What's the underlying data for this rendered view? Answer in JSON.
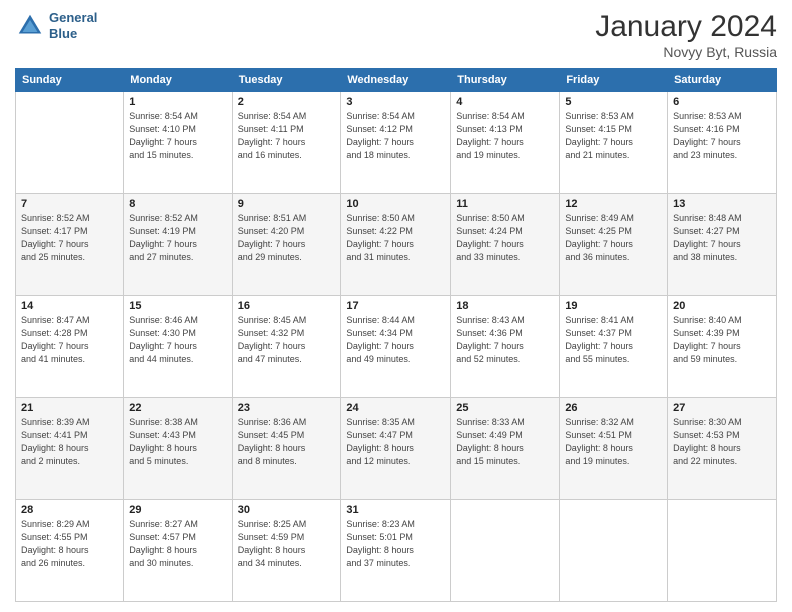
{
  "header": {
    "logo_line1": "General",
    "logo_line2": "Blue",
    "title": "January 2024",
    "subtitle": "Novyy Byt, Russia"
  },
  "weekdays": [
    "Sunday",
    "Monday",
    "Tuesday",
    "Wednesday",
    "Thursday",
    "Friday",
    "Saturday"
  ],
  "weeks": [
    [
      {
        "day": "",
        "info": ""
      },
      {
        "day": "1",
        "info": "Sunrise: 8:54 AM\nSunset: 4:10 PM\nDaylight: 7 hours\nand 15 minutes."
      },
      {
        "day": "2",
        "info": "Sunrise: 8:54 AM\nSunset: 4:11 PM\nDaylight: 7 hours\nand 16 minutes."
      },
      {
        "day": "3",
        "info": "Sunrise: 8:54 AM\nSunset: 4:12 PM\nDaylight: 7 hours\nand 18 minutes."
      },
      {
        "day": "4",
        "info": "Sunrise: 8:54 AM\nSunset: 4:13 PM\nDaylight: 7 hours\nand 19 minutes."
      },
      {
        "day": "5",
        "info": "Sunrise: 8:53 AM\nSunset: 4:15 PM\nDaylight: 7 hours\nand 21 minutes."
      },
      {
        "day": "6",
        "info": "Sunrise: 8:53 AM\nSunset: 4:16 PM\nDaylight: 7 hours\nand 23 minutes."
      }
    ],
    [
      {
        "day": "7",
        "info": "Sunrise: 8:52 AM\nSunset: 4:17 PM\nDaylight: 7 hours\nand 25 minutes."
      },
      {
        "day": "8",
        "info": "Sunrise: 8:52 AM\nSunset: 4:19 PM\nDaylight: 7 hours\nand 27 minutes."
      },
      {
        "day": "9",
        "info": "Sunrise: 8:51 AM\nSunset: 4:20 PM\nDaylight: 7 hours\nand 29 minutes."
      },
      {
        "day": "10",
        "info": "Sunrise: 8:50 AM\nSunset: 4:22 PM\nDaylight: 7 hours\nand 31 minutes."
      },
      {
        "day": "11",
        "info": "Sunrise: 8:50 AM\nSunset: 4:24 PM\nDaylight: 7 hours\nand 33 minutes."
      },
      {
        "day": "12",
        "info": "Sunrise: 8:49 AM\nSunset: 4:25 PM\nDaylight: 7 hours\nand 36 minutes."
      },
      {
        "day": "13",
        "info": "Sunrise: 8:48 AM\nSunset: 4:27 PM\nDaylight: 7 hours\nand 38 minutes."
      }
    ],
    [
      {
        "day": "14",
        "info": "Sunrise: 8:47 AM\nSunset: 4:28 PM\nDaylight: 7 hours\nand 41 minutes."
      },
      {
        "day": "15",
        "info": "Sunrise: 8:46 AM\nSunset: 4:30 PM\nDaylight: 7 hours\nand 44 minutes."
      },
      {
        "day": "16",
        "info": "Sunrise: 8:45 AM\nSunset: 4:32 PM\nDaylight: 7 hours\nand 47 minutes."
      },
      {
        "day": "17",
        "info": "Sunrise: 8:44 AM\nSunset: 4:34 PM\nDaylight: 7 hours\nand 49 minutes."
      },
      {
        "day": "18",
        "info": "Sunrise: 8:43 AM\nSunset: 4:36 PM\nDaylight: 7 hours\nand 52 minutes."
      },
      {
        "day": "19",
        "info": "Sunrise: 8:41 AM\nSunset: 4:37 PM\nDaylight: 7 hours\nand 55 minutes."
      },
      {
        "day": "20",
        "info": "Sunrise: 8:40 AM\nSunset: 4:39 PM\nDaylight: 7 hours\nand 59 minutes."
      }
    ],
    [
      {
        "day": "21",
        "info": "Sunrise: 8:39 AM\nSunset: 4:41 PM\nDaylight: 8 hours\nand 2 minutes."
      },
      {
        "day": "22",
        "info": "Sunrise: 8:38 AM\nSunset: 4:43 PM\nDaylight: 8 hours\nand 5 minutes."
      },
      {
        "day": "23",
        "info": "Sunrise: 8:36 AM\nSunset: 4:45 PM\nDaylight: 8 hours\nand 8 minutes."
      },
      {
        "day": "24",
        "info": "Sunrise: 8:35 AM\nSunset: 4:47 PM\nDaylight: 8 hours\nand 12 minutes."
      },
      {
        "day": "25",
        "info": "Sunrise: 8:33 AM\nSunset: 4:49 PM\nDaylight: 8 hours\nand 15 minutes."
      },
      {
        "day": "26",
        "info": "Sunrise: 8:32 AM\nSunset: 4:51 PM\nDaylight: 8 hours\nand 19 minutes."
      },
      {
        "day": "27",
        "info": "Sunrise: 8:30 AM\nSunset: 4:53 PM\nDaylight: 8 hours\nand 22 minutes."
      }
    ],
    [
      {
        "day": "28",
        "info": "Sunrise: 8:29 AM\nSunset: 4:55 PM\nDaylight: 8 hours\nand 26 minutes."
      },
      {
        "day": "29",
        "info": "Sunrise: 8:27 AM\nSunset: 4:57 PM\nDaylight: 8 hours\nand 30 minutes."
      },
      {
        "day": "30",
        "info": "Sunrise: 8:25 AM\nSunset: 4:59 PM\nDaylight: 8 hours\nand 34 minutes."
      },
      {
        "day": "31",
        "info": "Sunrise: 8:23 AM\nSunset: 5:01 PM\nDaylight: 8 hours\nand 37 minutes."
      },
      {
        "day": "",
        "info": ""
      },
      {
        "day": "",
        "info": ""
      },
      {
        "day": "",
        "info": ""
      }
    ]
  ]
}
